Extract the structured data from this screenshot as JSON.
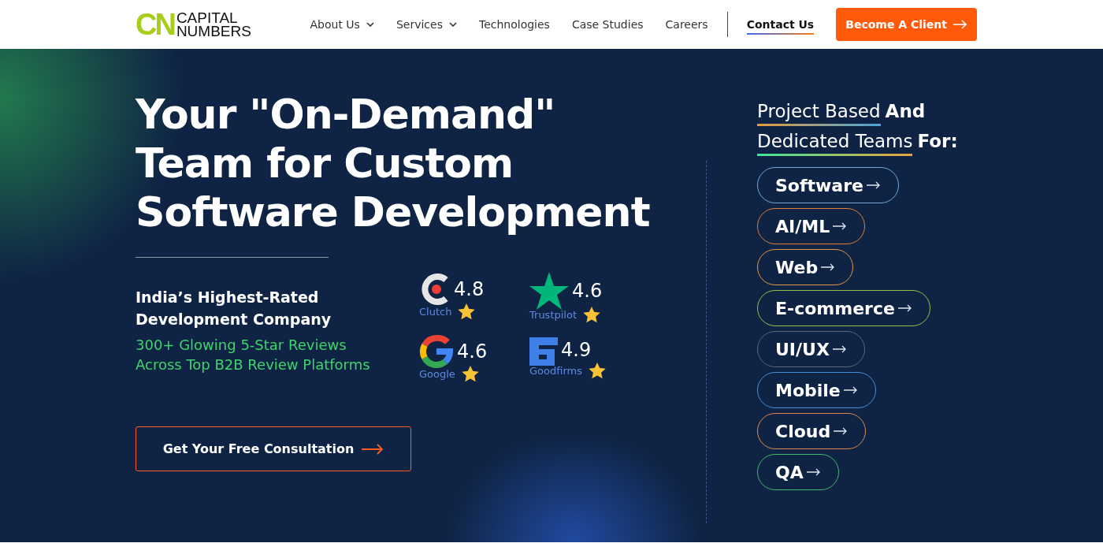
{
  "logo": {
    "mark": "CN",
    "line1": "CAPITAL",
    "line2": "NUMBERS"
  },
  "nav": [
    {
      "label": "About Us",
      "has_menu": true,
      "selected": false
    },
    {
      "label": "Services",
      "has_menu": true,
      "selected": false
    },
    {
      "label": "Technologies",
      "has_menu": false,
      "selected": false
    },
    {
      "label": "Case Studies",
      "has_menu": false,
      "selected": false
    },
    {
      "label": "Careers",
      "has_menu": false,
      "selected": false
    },
    {
      "label": "Contact Us",
      "has_menu": false,
      "selected": true
    }
  ],
  "cta_button": "Become A Client",
  "hero": {
    "headline": [
      "Your \"On-Demand\"",
      "Team for Custom",
      "Software Development"
    ],
    "subtitle": [
      "India’s Highest-Rated",
      "Development Company"
    ],
    "reviews_text": "300+ Glowing 5-Star Reviews Across Top B2B Review Platforms",
    "ratings": [
      {
        "kind": "clutch",
        "score": "4.8",
        "label": "Clutch"
      },
      {
        "kind": "trustpilot",
        "score": "4.6",
        "label": "Trustpilot"
      },
      {
        "kind": "google",
        "score": "4.6",
        "label": "Google"
      },
      {
        "kind": "goodfirms",
        "score": "4.9",
        "label": "Goodfirms"
      }
    ],
    "consultation_button": "Get Your Free Consultation"
  },
  "teams": {
    "heading": [
      {
        "light": "Project Based",
        "bold": "And"
      },
      {
        "light": "Dedicated Teams",
        "bold": "For:"
      }
    ],
    "services": [
      {
        "label": "Software",
        "color": "#6fa8dc"
      },
      {
        "label": "AI/ML",
        "color": "#d9823f"
      },
      {
        "label": "Web",
        "color": "#e8973a"
      },
      {
        "label": "E-commerce",
        "color": "#8bc34a"
      },
      {
        "label": "UI/UX",
        "color": "#5f6470"
      },
      {
        "label": "Mobile",
        "color": "#4a90d9"
      },
      {
        "label": "Cloud",
        "color": "#e0894a"
      },
      {
        "label": "QA",
        "color": "#3fb96b"
      }
    ]
  }
}
